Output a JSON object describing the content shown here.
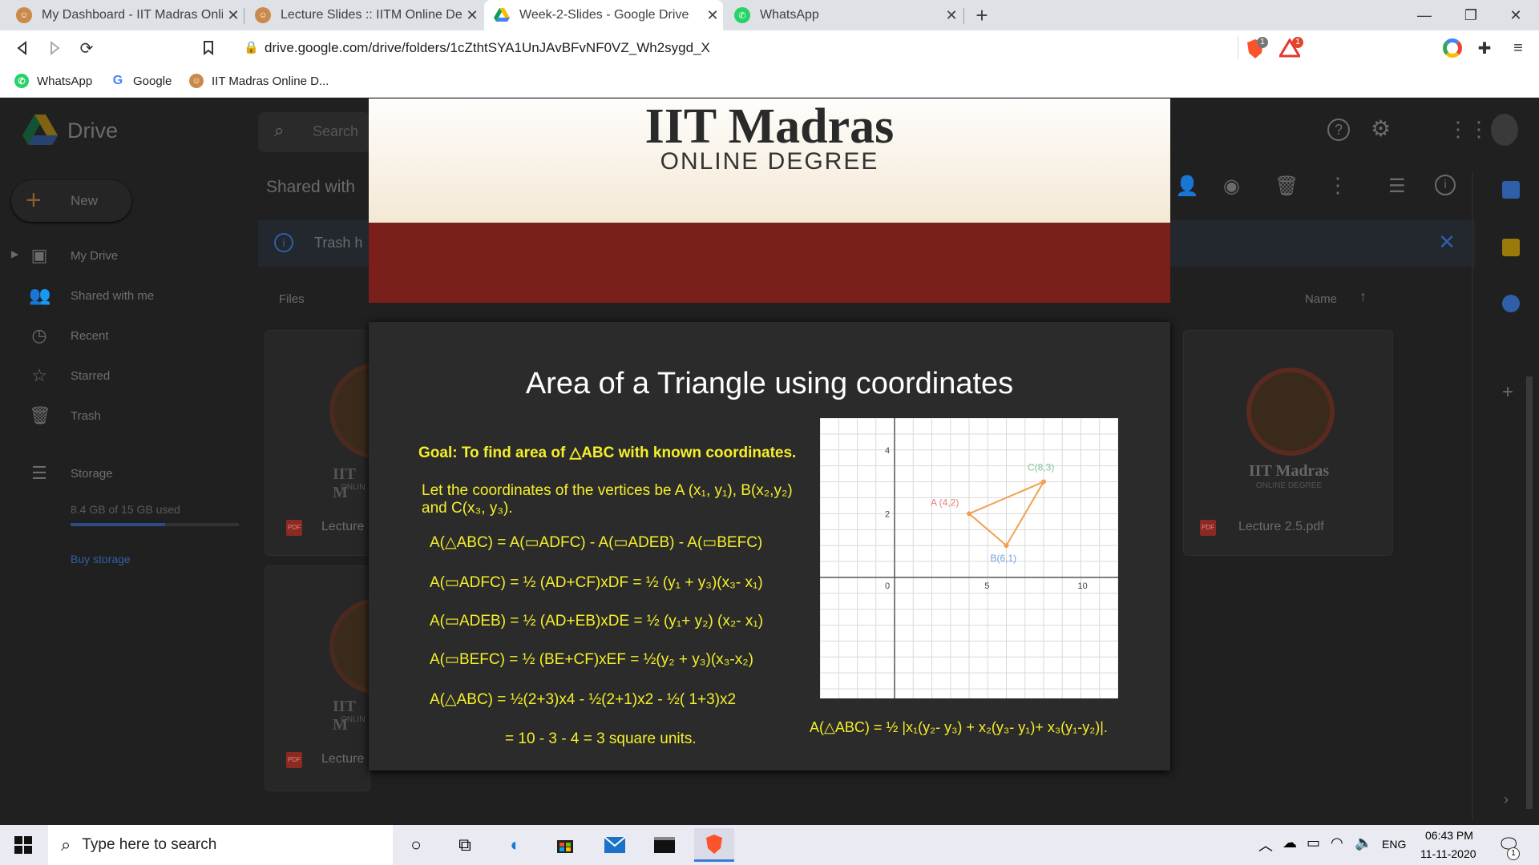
{
  "browser": {
    "tabs": [
      {
        "title": "My Dashboard - IIT Madras Online",
        "active": false
      },
      {
        "title": "Lecture Slides :: IITM Online Degre",
        "active": false
      },
      {
        "title": "Week-2-Slides - Google Drive",
        "active": true
      },
      {
        "title": "WhatsApp",
        "active": false
      }
    ],
    "url": "drive.google.com/drive/folders/1cZthtSYA1UnJAvBFvNF0VZ_Wh2sygd_X",
    "bookmarks": [
      "WhatsApp",
      "Google",
      "IIT Madras Online D..."
    ],
    "brave_badge": "1",
    "alert_badge": "1"
  },
  "drive": {
    "app_name": "Drive",
    "search_placeholder": "Search",
    "new_button": "New",
    "sidebar": [
      "My Drive",
      "Shared with me",
      "Recent",
      "Starred",
      "Trash"
    ],
    "storage_label": "Storage",
    "storage_used": "8.4 GB of 15 GB used",
    "storage_fraction": 0.56,
    "buy_storage": "Buy storage",
    "page_title": "Shared with",
    "banner_text": "Trash h",
    "files_label": "Files",
    "sort_label": "Name",
    "files": [
      "Lecture",
      "Lecture 2.5.pdf",
      "Lecture"
    ],
    "card_brand": "IIT Madras",
    "card_brand_short": "IIT M",
    "card_sub": "ONLINE DEGREE",
    "card_sub_short": "ONLIN",
    "pdf_badge": "PDF"
  },
  "slide_header": {
    "title": "IIT Madras",
    "subtitle": "ONLINE DEGREE"
  },
  "slide": {
    "title": "Area of a Triangle using coordinates",
    "goal": "Goal: To find area of △ABC with known coordinates.",
    "lines": [
      "Let the coordinates of the vertices be A (x₁, y₁), B(x₂,y₂)",
      "and C(x₃, y₃).",
      "A(△ABC) = A(▭ADFC) - A(▭ADEB) - A(▭BEFC)",
      "A(▭ADFC) = ½ (AD+CF)xDF = ½ (y₁ + y₃)(x₃- x₁)",
      "A(▭ADEB) = ½ (AD+EB)xDE = ½ (y₁+ y₂) (x₂- x₁)",
      "A(▭BEFC) = ½ (BE+CF)xEF = ½(y₂ + y₃)(x₃-x₂)",
      "A(△ABC) = ½(2+3)x4 -  ½(2+1)x2 - ½( 1+3)x2",
      "= 10 - 3 - 4 = 3 square units."
    ],
    "formula": "A(△ABC) = ½ |x₁(y₂- y₃) + x₂(y₃- y₁)+ x₃(y₁-y₂)|."
  },
  "chart_data": {
    "type": "scatter",
    "x_ticks": [
      "0",
      "5",
      "10"
    ],
    "y_ticks": [
      "2",
      "4"
    ],
    "xlim": [
      -4,
      12
    ],
    "ylim": [
      -3.8,
      5
    ],
    "grid": true,
    "points": [
      {
        "label": "A (4,2)",
        "x": 4,
        "y": 2,
        "color": "#e8807a"
      },
      {
        "label": "B(6,1)",
        "x": 6,
        "y": 1,
        "color": "#6fa2d8"
      },
      {
        "label": "C(8,3)",
        "x": 8,
        "y": 3,
        "color": "#7cc49a"
      }
    ],
    "triangle_color": "#f0a050"
  },
  "taskbar": {
    "search_placeholder": "Type here to search",
    "time": "06:43 PM",
    "date": "11-11-2020",
    "lang": "ENG",
    "notif_count": "1"
  }
}
